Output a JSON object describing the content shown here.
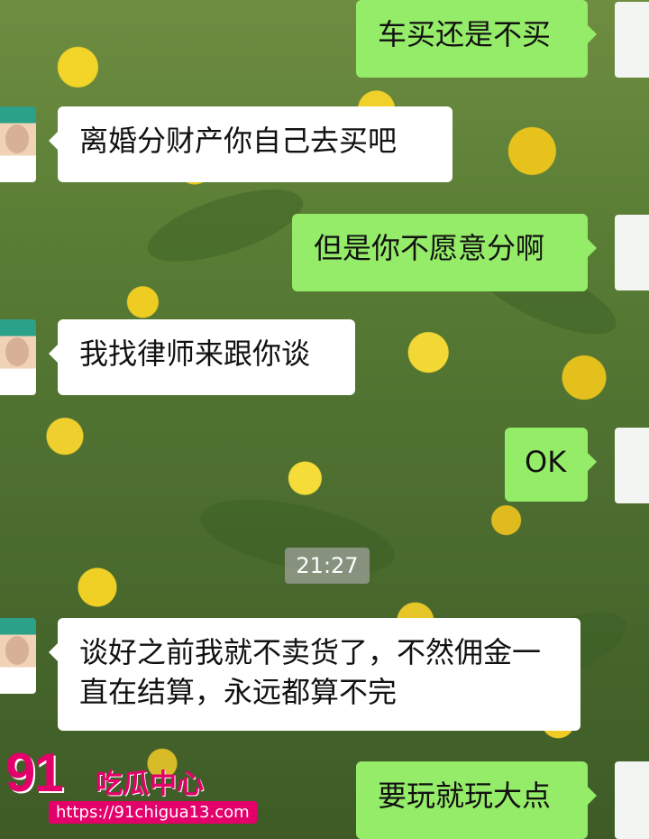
{
  "messages": [
    {
      "side": "right",
      "text": "车买还是不买"
    },
    {
      "side": "left",
      "text": "离婚分财产你自己去买吧"
    },
    {
      "side": "right",
      "text": "但是你不愿意分啊"
    },
    {
      "side": "left",
      "text": "我找律师来跟你谈"
    },
    {
      "side": "right",
      "text": "OK"
    },
    {
      "side": "left",
      "text": "谈好之前我就不卖货了，不然佣金一直在结算，永远都算不完"
    },
    {
      "side": "right",
      "text": "要玩就玩大点"
    }
  ],
  "timestamp": "21:27",
  "watermark": {
    "logo": "91",
    "title": "吃瓜中心",
    "url": "https://91chigua13.com"
  }
}
